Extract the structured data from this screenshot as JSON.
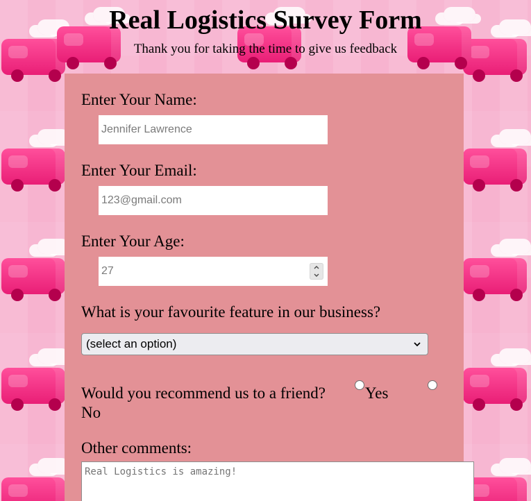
{
  "header": {
    "title": "Real Logistics Survey Form",
    "subtitle": "Thank you for taking the time to give us feedback"
  },
  "form": {
    "name": {
      "label": "Enter Your Name:",
      "placeholder": "Jennifer Lawrence"
    },
    "email": {
      "label": "Enter Your Email:",
      "placeholder": "123@gmail.com"
    },
    "age": {
      "label": "Enter Your Age:",
      "placeholder": "27"
    },
    "feature": {
      "label": "What is your favourite feature in our business?",
      "selected": "(select an option)"
    },
    "recommend": {
      "question": "Would you recommend us to a friend?",
      "yes": "Yes",
      "no": "No"
    },
    "comments": {
      "label": "Other comments:",
      "placeholder": "Real Logistics is amazing!"
    }
  },
  "icons": {
    "stepper": "up-down-arrows-icon",
    "select_chevron": "chevron-down-icon",
    "background": "delivery-van-pattern-icon"
  },
  "colors": {
    "page_background": "#f7b3cf",
    "panel_background": "#e39196",
    "van": "#e91e76"
  }
}
